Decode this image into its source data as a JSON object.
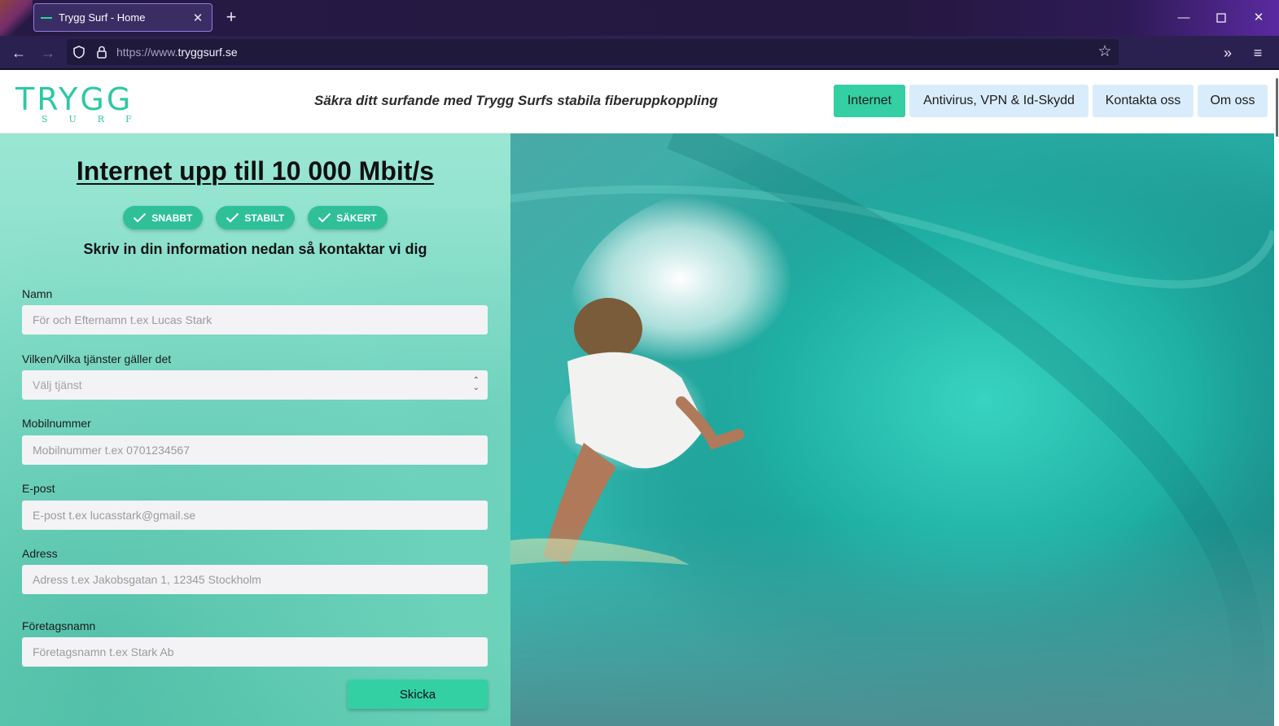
{
  "browser": {
    "tab_title": "Trygg Surf - Home",
    "url_prefix": "https://www.",
    "url_domain": "tryggsurf.se"
  },
  "header": {
    "logo_main": "TRYGG",
    "logo_sub": "SURF",
    "tagline": "Säkra ditt surfande med Trygg Surfs stabila fiberuppkoppling",
    "menu": [
      {
        "label": "Internet",
        "active": true
      },
      {
        "label": "Antivirus, VPN & Id-Skydd",
        "active": false
      },
      {
        "label": "Kontakta oss",
        "active": false
      },
      {
        "label": "Om oss",
        "active": false
      }
    ]
  },
  "hero": {
    "headline": "Internet upp till 10 000 Mbit/s",
    "badges": [
      "SNABBT",
      "STABILT",
      "SÄKERT"
    ],
    "subhead": "Skriv in din information nedan så kontaktar vi dig"
  },
  "form": {
    "name_label": "Namn",
    "name_placeholder": "För och Efternamn t.ex Lucas Stark",
    "service_label": "Vilken/Vilka tjänster gäller det",
    "service_placeholder": "Välj tjänst",
    "mobile_label": "Mobilnummer",
    "mobile_placeholder": "Mobilnummer t.ex 0701234567",
    "email_label": "E-post",
    "email_placeholder": "E-post t.ex lucasstark@gmail.se",
    "address_label": "Adress",
    "address_placeholder": "Adress t.ex Jakobsgatan 1, 12345 Stockholm",
    "company_label": "Företagsnamn",
    "company_placeholder": "Företagsnamn t.ex Stark Ab",
    "submit_label": "Skicka"
  },
  "colors": {
    "accent": "#34cfa2",
    "menu_inactive": "#d9ecfb",
    "browser_chrome": "#2b2151"
  }
}
